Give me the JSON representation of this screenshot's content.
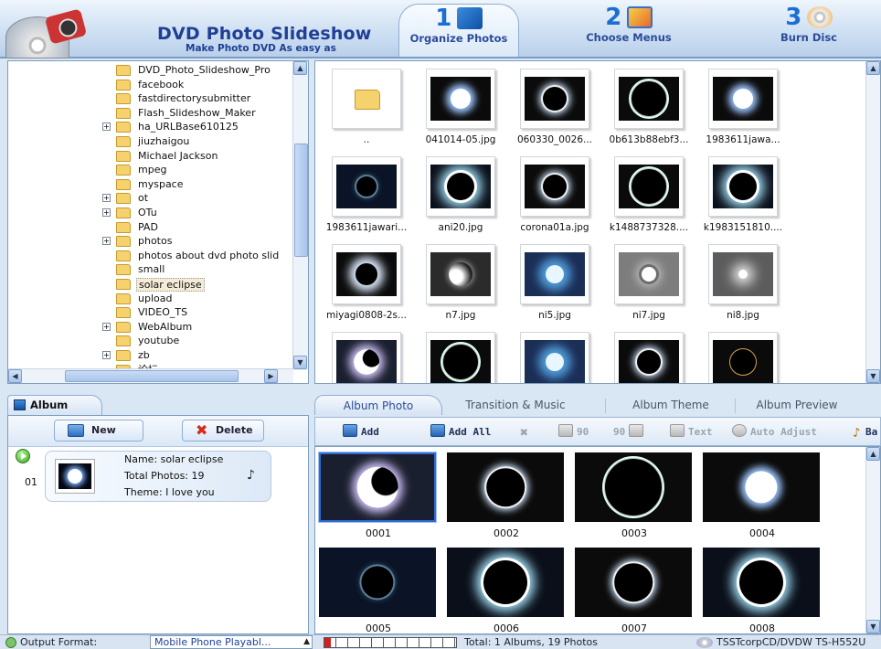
{
  "header": {
    "title": "DVD Photo Slideshow",
    "subtitle": "Make Photo DVD As easy as",
    "steps": [
      {
        "num": "1",
        "label": "Organize Photos",
        "active": true
      },
      {
        "num": "2",
        "label": "Choose Menus",
        "active": false
      },
      {
        "num": "3",
        "label": "Burn Disc",
        "active": false
      }
    ]
  },
  "folder_tree": {
    "items": [
      {
        "name": "DVD_Photo_Slideshow_Pro",
        "expandable": false
      },
      {
        "name": "facebook",
        "expandable": false
      },
      {
        "name": "fastdirectorysubmitter",
        "expandable": false
      },
      {
        "name": "Flash_Slideshow_Maker",
        "expandable": false
      },
      {
        "name": "ha_URLBase610125",
        "expandable": true
      },
      {
        "name": "jiuzhaigou",
        "expandable": false
      },
      {
        "name": "Michael Jackson",
        "expandable": false
      },
      {
        "name": "mpeg",
        "expandable": false
      },
      {
        "name": "myspace",
        "expandable": false
      },
      {
        "name": "ot",
        "expandable": true
      },
      {
        "name": "OTu",
        "expandable": true
      },
      {
        "name": "PAD",
        "expandable": false
      },
      {
        "name": "photos",
        "expandable": true
      },
      {
        "name": "photos about dvd  photo slid",
        "expandable": false
      },
      {
        "name": "small",
        "expandable": false
      },
      {
        "name": "solar eclipse",
        "expandable": false,
        "selected": true
      },
      {
        "name": "upload",
        "expandable": false
      },
      {
        "name": "VIDEO_TS",
        "expandable": false
      },
      {
        "name": "WebAlbum",
        "expandable": true
      },
      {
        "name": "youtube",
        "expandable": false
      },
      {
        "name": "zb",
        "expandable": true
      },
      {
        "name": "论坛",
        "expandable": false
      }
    ]
  },
  "browser": {
    "files": [
      {
        "name": "..",
        "kind": "folder"
      },
      {
        "name": "041014-05.jpg",
        "kind": "photo",
        "style": "glow"
      },
      {
        "name": "060330_0026...",
        "kind": "photo",
        "style": "ring"
      },
      {
        "name": "0b613b88ebf3...",
        "kind": "photo",
        "style": "ringbig"
      },
      {
        "name": "1983611jawa...",
        "kind": "photo",
        "style": "glow"
      },
      {
        "name": "1983611jawari...",
        "kind": "photo",
        "style": "dimring"
      },
      {
        "name": "ani20.jpg",
        "kind": "photo",
        "style": "corona"
      },
      {
        "name": "corona01a.jpg",
        "kind": "photo",
        "style": "ring"
      },
      {
        "name": "k1488737328....",
        "kind": "photo",
        "style": "ringbig"
      },
      {
        "name": "k1983151810....",
        "kind": "photo",
        "style": "corona"
      },
      {
        "name": "miyagi0808-2s...",
        "kind": "photo",
        "style": "black"
      },
      {
        "name": "n7.jpg",
        "kind": "photo",
        "style": "crescent"
      },
      {
        "name": "ni5.jpg",
        "kind": "photo",
        "style": "blueglow"
      },
      {
        "name": "ni7.jpg",
        "kind": "photo",
        "style": "grey"
      },
      {
        "name": "ni8.jpg",
        "kind": "photo",
        "style": "spark"
      },
      {
        "name": "",
        "kind": "photo",
        "style": "partial"
      },
      {
        "name": "",
        "kind": "photo",
        "style": "ringbig"
      },
      {
        "name": "",
        "kind": "photo",
        "style": "blueglow"
      },
      {
        "name": "",
        "kind": "photo",
        "style": "ring"
      },
      {
        "name": "",
        "kind": "photo",
        "style": "thinring"
      }
    ]
  },
  "album_panel": {
    "tab_label": "Album",
    "new_label": "New",
    "delete_label": "Delete",
    "albums": [
      {
        "index": "01",
        "name": "Name: solar eclipse",
        "total": "Total Photos: 19",
        "theme": "Theme: I love you"
      }
    ]
  },
  "right_tabs": {
    "tabs": [
      "Album Photo",
      "Transition & Music",
      "Album Theme",
      "Album Preview"
    ],
    "active": 0
  },
  "toolbar": {
    "add": "Add",
    "add_all": "Add All",
    "rotate_left": "90",
    "rotate_right": "90",
    "text": "Text",
    "auto_adjust": "Auto Adjust",
    "background": "Ba"
  },
  "album_photos": [
    {
      "label": "0001",
      "style": "partial",
      "selected": true
    },
    {
      "label": "0002",
      "style": "ring"
    },
    {
      "label": "0003",
      "style": "ringbig"
    },
    {
      "label": "0004",
      "style": "glow"
    },
    {
      "label": "0005",
      "style": "dimring"
    },
    {
      "label": "0006",
      "style": "corona"
    },
    {
      "label": "0007",
      "style": "ring"
    },
    {
      "label": "0008",
      "style": "corona"
    }
  ],
  "statusbar": {
    "output_label": "Output Format:",
    "format_value": "Mobile Phone Playabl...",
    "capacity_fraction": 0.05,
    "total_text": "Total: 1 Albums, 19 Photos",
    "drive_text": "TSSTcorpCD/DVDW TS-H552U"
  }
}
